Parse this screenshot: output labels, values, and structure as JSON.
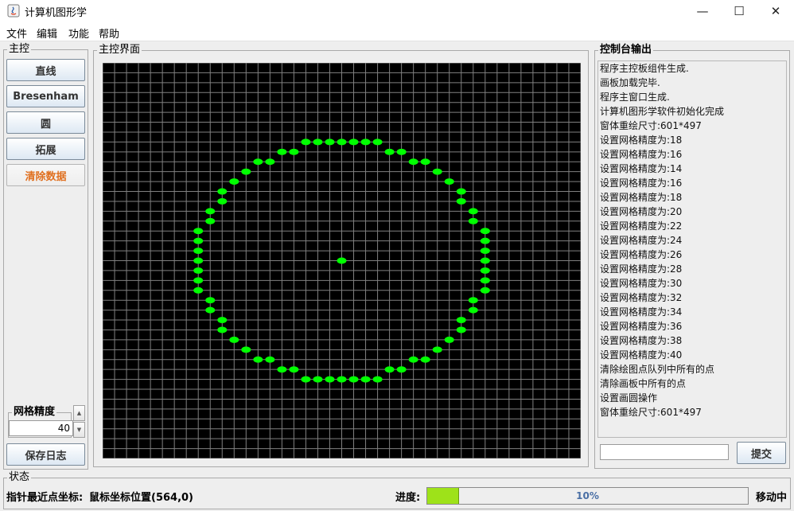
{
  "window": {
    "title": "计算机图形学",
    "min_glyph": "—",
    "max_glyph": "☐",
    "close_glyph": "✕"
  },
  "menu": [
    "文件",
    "编辑",
    "功能",
    "帮助"
  ],
  "left_panel": {
    "title": "主控",
    "buttons": [
      "直线",
      "Bresenham",
      "圆",
      "拓展",
      "清除数据"
    ],
    "grid_group_title": "网格精度",
    "grid_value": "40",
    "save_label": "保存日志"
  },
  "main_panel": {
    "title": "主控界面",
    "grid_cells": 40,
    "background_color": "#000000",
    "grid_color": "#808080",
    "point_color": "#00ff00",
    "circle": {
      "center": [
        0,
        0
      ],
      "radius": 12
    }
  },
  "console": {
    "title": "控制台输出",
    "lines": [
      "程序主控板组件生成.",
      "画板加载完毕.",
      "程序主窗口生成.",
      "计算机图形学软件初始化完成",
      "窗体重绘尺寸:601*497",
      "设置网格精度为:18",
      "设置网格精度为:16",
      "设置网格精度为:14",
      "设置网格精度为:16",
      "设置网格精度为:18",
      "设置网格精度为:20",
      "设置网格精度为:22",
      "设置网格精度为:24",
      "设置网格精度为:26",
      "设置网格精度为:28",
      "设置网格精度为:30",
      "设置网格精度为:32",
      "设置网格精度为:34",
      "设置网格精度为:36",
      "设置网格精度为:38",
      "设置网格精度为:40",
      "清除绘图点队列中所有的点",
      "清除画板中所有的点",
      "设置画圆操作",
      "窗体重绘尺寸:601*497"
    ],
    "input_value": "",
    "submit_label": "提交"
  },
  "status": {
    "title": "状态",
    "nearest_point_label": "指针最近点坐标:",
    "mouse_position": "鼠标坐标位置(564,0)",
    "progress_label": "进度:",
    "progress_value": 0.1,
    "progress_text": "10%",
    "state_text": "移动中",
    "progress_color": "#9ee219"
  }
}
